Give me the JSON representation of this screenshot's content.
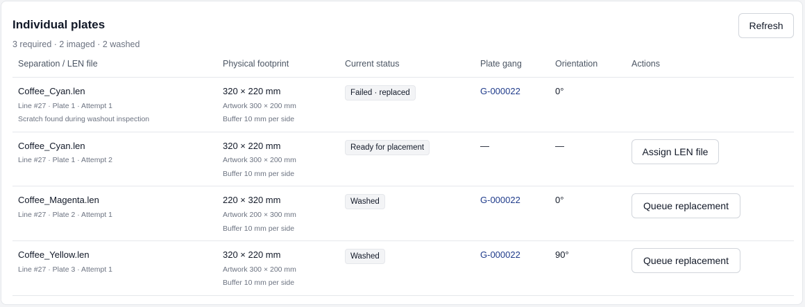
{
  "header": {
    "title": "Individual plates",
    "summary": "3 required · 2 imaged · 2 washed",
    "refresh_label": "Refresh"
  },
  "columns": [
    "Separation / LEN file",
    "Physical footprint",
    "Current status",
    "Plate gang",
    "Orientation",
    "Actions"
  ],
  "rows": [
    {
      "file": "Coffee_Cyan.len",
      "meta": "Line #27 · Plate 1 · Attempt 1",
      "note": "Scratch found during washout inspection",
      "size": "320 × 220 mm",
      "artwork": "Artwork 300 × 200 mm",
      "buffer": "Buffer 10 mm per side",
      "status": "Failed · replaced",
      "gang": "G-000022",
      "orientation": "0°",
      "action": ""
    },
    {
      "file": "Coffee_Cyan.len",
      "meta": "Line #27 · Plate 1 · Attempt 2",
      "size": "320 × 220 mm",
      "artwork": "Artwork 300 × 200 mm",
      "buffer": "Buffer 10 mm per side",
      "status": "Ready for placement",
      "gang": "—",
      "orientation": "—",
      "action": "Assign LEN file"
    },
    {
      "file": "Coffee_Magenta.len",
      "meta": "Line #27 · Plate 2 · Attempt 1",
      "size": "220 × 320 mm",
      "artwork": "Artwork 200 × 300 mm",
      "buffer": "Buffer 10 mm per side",
      "status": "Washed",
      "gang": "G-000022",
      "orientation": "0°",
      "action": "Queue replacement"
    },
    {
      "file": "Coffee_Yellow.len",
      "meta": "Line #27 · Plate 3 · Attempt 1",
      "size": "320 × 220 mm",
      "artwork": "Artwork 300 × 200 mm",
      "buffer": "Buffer 10 mm per side",
      "status": "Washed",
      "gang": "G-000022",
      "orientation": "90°",
      "action": "Queue replacement"
    }
  ]
}
